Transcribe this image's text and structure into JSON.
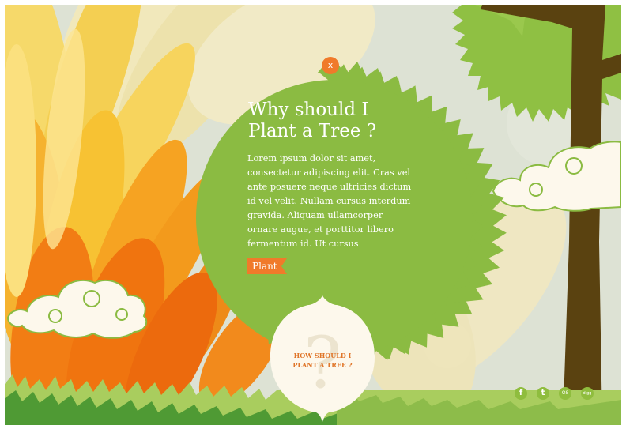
{
  "panel": {
    "close_label": "x",
    "title_line1": "Why should I",
    "title_line2": "Plant a Tree ?",
    "body": "Lorem ipsum dolor sit amet, consectetur adipiscing elit. Cras vel ante posuere neque ultricies dictum id vel velit. Nullam cursus interdum gravida. Aliquam ullamcorper ornare augue, et porttitor libero fermentum id. Ut cursus",
    "plant_label": "Plant"
  },
  "how_bubble": {
    "line1": "HOW SHOULD I",
    "line2": "PLANT A TREE ?"
  },
  "social": [
    {
      "icon": "facebook-icon",
      "glyph": "f"
    },
    {
      "icon": "twitter-icon",
      "glyph": "t"
    },
    {
      "icon": "os-icon",
      "glyph": "OS"
    },
    {
      "icon": "digg-icon",
      "glyph": "digg"
    }
  ],
  "colors": {
    "sky": "#dfe3d6",
    "panel_green": "#8bbb42",
    "tree_green": "#8fc043",
    "trunk": "#5a4210",
    "accent_orange": "#f07a2a",
    "cream": "#fdf8ec"
  }
}
